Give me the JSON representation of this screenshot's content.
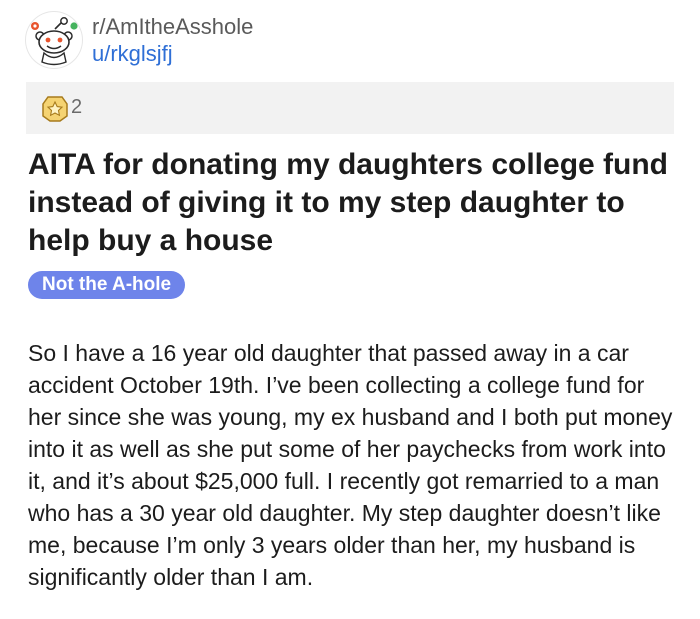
{
  "post": {
    "subreddit": "r/AmItheAsshole",
    "author": "u/rkglsjfj",
    "avatar_icon": "reddit-snoo-icon",
    "awards": {
      "icon": "award-badge-icon",
      "count": "2"
    },
    "title": "AITA for donating my daughters college fund instead of giving it to my step daughter to help buy a house",
    "flair": {
      "label": "Not the A-hole",
      "color": "#6e84ea"
    },
    "body": "So I have a 16 year old daughter that passed away in a car accident October 19th. I’ve been collecting a college fund for her since she was young, my ex husband and I both put money into it as well as she put some of her paychecks from work into it, and it’s about $25,000 full. I recently got remarried to a man who has a 30 year old daughter. My step daughter doesn’t like me, because I’m only 3 years older than her, my husband is significantly older than I am."
  },
  "colors": {
    "link_blue": "#2f6fd6",
    "awards_bar_bg": "#f2f2f2"
  }
}
